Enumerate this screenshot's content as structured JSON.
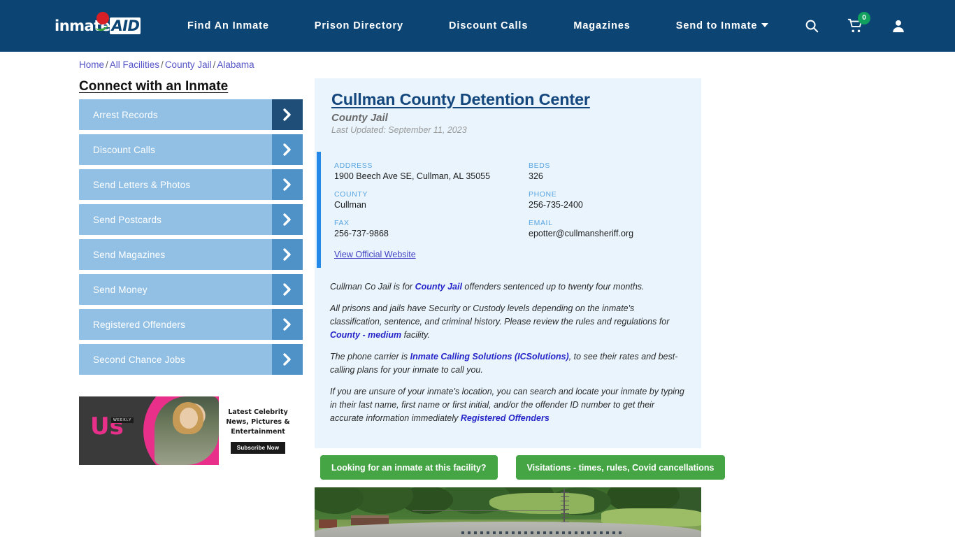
{
  "nav": {
    "logo": {
      "primary": "inmate",
      "secondary": "AID"
    },
    "links": [
      {
        "label": "Find An Inmate",
        "has_caret": false
      },
      {
        "label": "Prison Directory",
        "has_caret": false
      },
      {
        "label": "Discount Calls",
        "has_caret": false
      },
      {
        "label": "Magazines",
        "has_caret": false
      },
      {
        "label": "Send to Inmate",
        "has_caret": true
      }
    ],
    "icons": {
      "search": "search-icon",
      "cart": "cart-icon",
      "cart_count": "0",
      "account": "user-icon"
    },
    "bg_color": "#0c4574",
    "badge_color": "#12a05f"
  },
  "breadcrumb": {
    "items": [
      "Home",
      "All Facilities",
      "County Jail",
      "Alabama"
    ],
    "separator": "/"
  },
  "sidebar": {
    "heading": "Connect with an Inmate",
    "items": [
      {
        "label": "Arrest Records"
      },
      {
        "label": "Discount Calls"
      },
      {
        "label": "Send Letters & Photos"
      },
      {
        "label": "Send Postcards"
      },
      {
        "label": "Send Magazines"
      },
      {
        "label": "Send Money"
      },
      {
        "label": "Registered Offenders"
      },
      {
        "label": "Second Chance Jobs"
      }
    ],
    "item_color": "#92c0e4",
    "arrow_color": "#4f92c8",
    "arrow_active_color": "#1f4e79"
  },
  "ad": {
    "brand": "Us",
    "brand_sub": "WEEKLY",
    "copy_line1": "Latest Celebrity",
    "copy_line2": "News, Pictures &",
    "copy_line3": "Entertainment",
    "cta": "Subscribe Now"
  },
  "facility": {
    "name": "Cullman County Detention Center",
    "type": "County Jail",
    "last_updated": "Last Updated: September 11, 2023",
    "info": [
      {
        "label": "ADDRESS",
        "value": "1900 Beech Ave SE, Cullman, AL 35055"
      },
      {
        "label": "BEDS",
        "value": "326"
      },
      {
        "label": "COUNTY",
        "value": "Cullman"
      },
      {
        "label": "PHONE",
        "value": "256-735-2400"
      },
      {
        "label": "FAX",
        "value": "256-737-9868"
      },
      {
        "label": "EMAIL",
        "value": "epotter@cullmansheriff.org"
      }
    ],
    "official_website_link": "View Official Website",
    "accent_color": "#2388e8",
    "panel_color": "#e9f4fc"
  },
  "description": {
    "p1_a": "Cullman Co Jail is for ",
    "p1_link": "County Jail",
    "p1_b": " offenders sentenced up to twenty four months.",
    "p2_a": "All prisons and jails have Security or Custody levels depending on the inmate's classification, sentence, and criminal history. Please review the rules and regulations for ",
    "p2_link": "County - medium",
    "p2_b": " facility.",
    "p3_a": "The phone carrier is ",
    "p3_link": "Inmate Calling Solutions (ICSolutions)",
    "p3_b": ", to see their rates and best-calling plans for your inmate to call you.",
    "p4_a": "If you are unsure of your inmate's location, you can search and locate your inmate by typing in their last name, first name or first initial, and/or the offender ID number to get their accurate information immediately ",
    "p4_link": "Registered Offenders"
  },
  "actions": {
    "inmate_search": "Looking for an inmate at this facility?",
    "visitations": "Visitations - times, rules, Covid cancellations",
    "color": "#45a545"
  }
}
